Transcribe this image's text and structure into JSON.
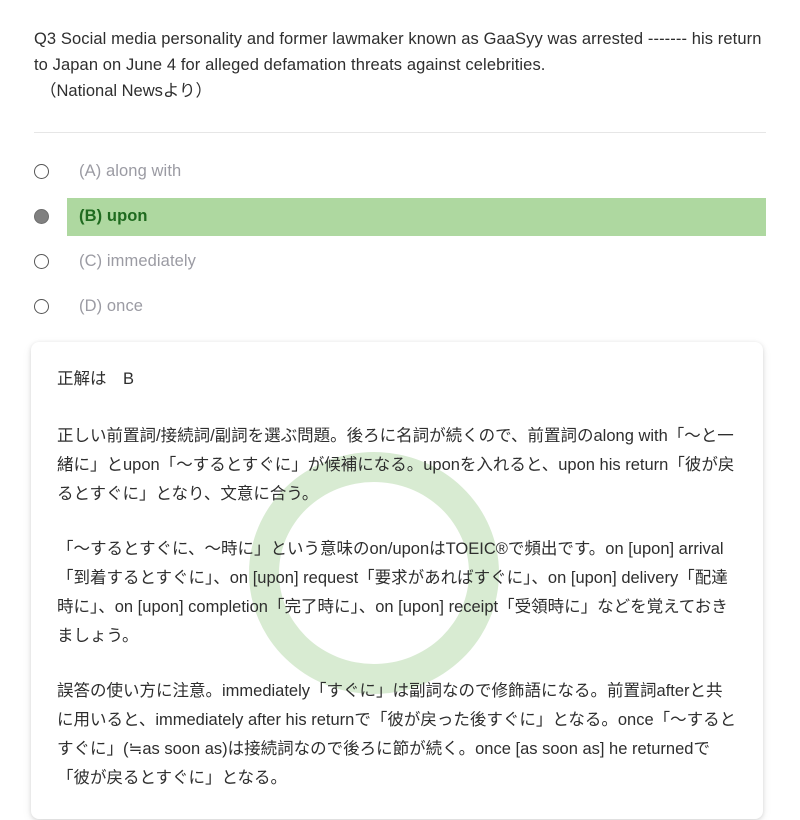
{
  "question": {
    "number": "Q3",
    "text": "Q3 Social media personality and former lawmaker known as GaaSyy was arrested ------- his return to Japan on June 4 for alleged defamation threats against celebrities.",
    "source": "（National Newsより）"
  },
  "options": [
    {
      "id": "A",
      "label": "(A) along with",
      "selected": false,
      "correct": false
    },
    {
      "id": "B",
      "label": "(B) upon",
      "selected": true,
      "correct": true
    },
    {
      "id": "C",
      "label": "(C) immediately",
      "selected": false,
      "correct": false
    },
    {
      "id": "D",
      "label": "(D) once",
      "selected": false,
      "correct": false
    }
  ],
  "explanation": {
    "answer_line": "正解は　B",
    "paragraphs": [
      "正しい前置詞/接続詞/副詞を選ぶ問題。後ろに名詞が続くので、前置詞のalong with「〜と一緒に」とupon「〜するとすぐに」が候補になる。uponを入れると、upon his return「彼が戻るとすぐに」となり、文意に合う。",
      "「〜するとすぐに、〜時に」という意味のon/uponはTOEIC®で頻出です。on [upon] arrival「到着するとすぐに」、on [upon] request「要求があればすぐに」、on [upon] delivery「配達時に」、on [upon] completion「完了時に」、on [upon] receipt「受領時に」などを覚えておきましょう。",
      "誤答の使い方に注意。immediately「すぐに」は副詞なので修飾語になる。前置詞afterと共に用いると、immediately after his returnで「彼が戻った後すぐに」となる。once「〜するとすぐに」(≒as soon as)は接続詞なので後ろに節が続く。once [as soon as] he returnedで「彼が戻るとすぐに」となる。"
    ]
  },
  "colors": {
    "correct_highlight_bg": "#aed8a0",
    "correct_text": "#1f6b1f",
    "option_text": "#9b9ba3",
    "body_text": "#2e2e2e",
    "divider": "#e6e6e6",
    "watermark_ring": "#d8ebd2",
    "selected_radio_fill": "#808080"
  }
}
